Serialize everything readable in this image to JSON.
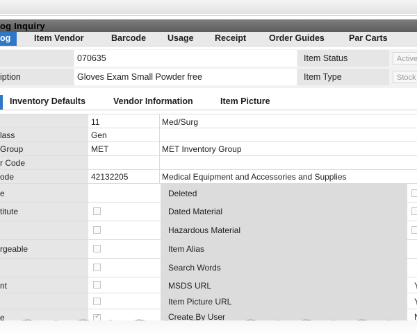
{
  "window": {
    "title": "og Inquiry"
  },
  "nav_tabs": [
    {
      "label": "og",
      "active": true
    },
    {
      "label": "Item Vendor"
    },
    {
      "label": "Barcode"
    },
    {
      "label": "Usage"
    },
    {
      "label": "Receipt"
    },
    {
      "label": "Order Guides"
    },
    {
      "label": "Par Carts"
    }
  ],
  "header": {
    "item_number": "070635",
    "description_label": "iption",
    "description": "Gloves Exam Small Powder free",
    "item_status_label": "Item Status",
    "item_status_value": "Active",
    "item_type_label": "Item Type",
    "item_type_value": "Stock"
  },
  "sub_tabs": [
    "Inventory Defaults",
    "Vendor Information",
    "Item Picture"
  ],
  "fields": [
    {
      "label": "",
      "code": "11",
      "desc": "Med/Surg"
    },
    {
      "label": "lass",
      "code": "Gen",
      "desc": ""
    },
    {
      "label": "Group",
      "code": "MET",
      "desc": "MET Inventory Group"
    },
    {
      "label": "r Code",
      "code": "",
      "desc": ""
    },
    {
      "label": "ode",
      "code": "42132205",
      "desc": "Medical Equipment and Accessories and Supplies"
    }
  ],
  "flags": [
    {
      "left_label": "e",
      "right_label": "Deleted",
      "right_value": ""
    },
    {
      "left_label": "titute",
      "right_label": "Dated Material",
      "right_value": ""
    },
    {
      "left_label": "",
      "right_label": "Hazardous Material",
      "right_value": ""
    },
    {
      "left_label": "rgeable",
      "right_label": "Item Alias",
      "right_value": ""
    },
    {
      "left_label": "",
      "right_label": "Search Words",
      "right_value": ""
    },
    {
      "left_label": "nt",
      "right_label": "MSDS URL",
      "right_value": "Y"
    },
    {
      "left_label": "",
      "right_label": "Item Picture URL",
      "right_value": "Y"
    },
    {
      "left_label": "e",
      "right_label": "Create By User",
      "right_value": "N"
    }
  ],
  "colors": {
    "accent": "#2f78c5",
    "label_bg": "#e6e6e6",
    "flag_bg": "#dcdcdc"
  }
}
